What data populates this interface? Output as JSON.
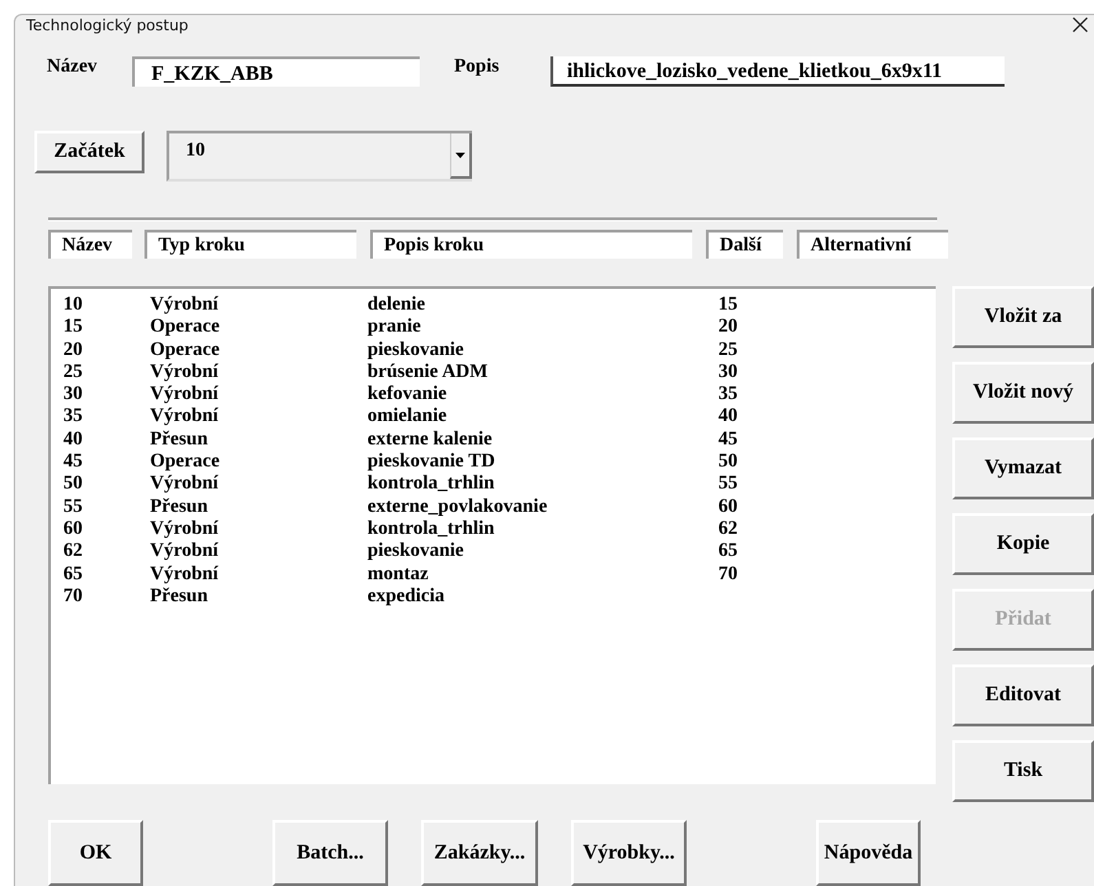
{
  "window": {
    "title": "Technologický postup"
  },
  "name_field": {
    "label": "Název",
    "value": "F_KZK_ABB"
  },
  "description_field": {
    "label": "Popis",
    "value": "ihlickove_lozisko_vedene_klietkou_6x9x11"
  },
  "start": {
    "button": "Začátek",
    "value": "10"
  },
  "columns": [
    "Název",
    "Typ kroku",
    "Popis kroku",
    "Další",
    "Alternativní"
  ],
  "rows": [
    {
      "name": "10",
      "type": "Výrobní",
      "description": "delenie",
      "next": "15"
    },
    {
      "name": "15",
      "type": "Operace",
      "description": "pranie",
      "next": "20"
    },
    {
      "name": "20",
      "type": "Operace",
      "description": "pieskovanie",
      "next": "25"
    },
    {
      "name": "25",
      "type": "Výrobní",
      "description": "brúsenie ADM",
      "next": "30"
    },
    {
      "name": "30",
      "type": "Výrobní",
      "description": "kefovanie",
      "next": "35"
    },
    {
      "name": "35",
      "type": "Výrobní",
      "description": "omielanie",
      "next": "40"
    },
    {
      "name": "40",
      "type": "Přesun",
      "description": "externe kalenie",
      "next": "45"
    },
    {
      "name": "45",
      "type": "Operace",
      "description": "pieskovanie TD",
      "next": "50"
    },
    {
      "name": "50",
      "type": "Výrobní",
      "description": "kontrola_trhlin",
      "next": "55"
    },
    {
      "name": "55",
      "type": "Přesun",
      "description": "externe_povlakovanie",
      "next": "60"
    },
    {
      "name": "60",
      "type": "Výrobní",
      "description": "kontrola_trhlin",
      "next": "62"
    },
    {
      "name": "62",
      "type": "Výrobní",
      "description": "pieskovanie",
      "next": "65"
    },
    {
      "name": "65",
      "type": "Výrobní",
      "description": "montaz",
      "next": "70"
    },
    {
      "name": "70",
      "type": "Přesun",
      "description": "expedicia"
    }
  ],
  "side_buttons": [
    {
      "label": "Vložit za",
      "disabled": false
    },
    {
      "label": "Vložit nový",
      "disabled": false
    },
    {
      "label": "Vymazat",
      "disabled": false
    },
    {
      "label": "Kopie",
      "disabled": false
    },
    {
      "label": "Přidat",
      "disabled": true
    },
    {
      "label": "Editovat",
      "disabled": false
    },
    {
      "label": "Tisk",
      "disabled": false
    }
  ],
  "bottom_buttons": [
    "OK",
    "Batch...",
    "Zakázky...",
    "Výrobky...",
    "Nápověda"
  ]
}
